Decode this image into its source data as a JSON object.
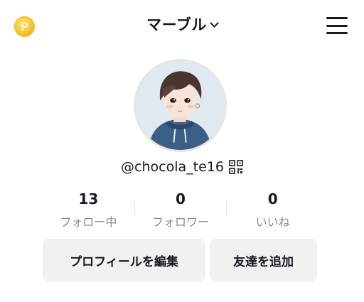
{
  "header": {
    "title": "マーブル",
    "coin_icon": "coin-icon",
    "menu_icon": "hamburger-menu-icon"
  },
  "profile": {
    "username": "@chocola_te16",
    "qr_icon": "qr-code-icon"
  },
  "stats": [
    {
      "value": "13",
      "label": "フォロー中"
    },
    {
      "value": "0",
      "label": "フォロワー"
    },
    {
      "value": "0",
      "label": "いいね"
    }
  ],
  "actions": {
    "edit_profile": "プロフィールを編集",
    "add_friends": "友達を追加"
  },
  "colors": {
    "coin": "#f7c52b",
    "button_bg": "#f1f1f2",
    "text": "#161823",
    "secondary_text": "#8a8b91"
  }
}
